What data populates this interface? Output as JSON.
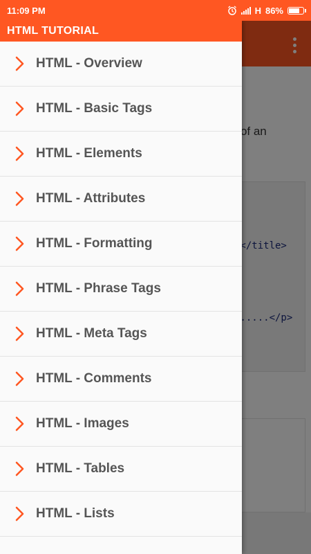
{
  "status": {
    "time": "11:09 PM",
    "network": "H",
    "battery_text": "86%",
    "battery_level": 0.86
  },
  "drawer": {
    "title": "HTML TUTORIAL",
    "items": [
      {
        "label": "HTML - Overview"
      },
      {
        "label": "HTML - Basic Tags"
      },
      {
        "label": "HTML - Elements"
      },
      {
        "label": "HTML - Attributes"
      },
      {
        "label": "HTML - Formatting"
      },
      {
        "label": "HTML - Phrase Tags"
      },
      {
        "label": "HTML - Meta Tags"
      },
      {
        "label": "HTML - Comments"
      },
      {
        "label": "HTML - Images"
      },
      {
        "label": "HTML - Tables"
      },
      {
        "label": "HTML - Lists"
      }
    ]
  },
  "background": {
    "text_fragment": "le of an",
    "code_fragments": [
      "e</title>",
      "e.....</p>"
    ]
  },
  "colors": {
    "accent": "#ff5722",
    "chevron": "#ff5722",
    "label": "#555555"
  },
  "icons": {
    "chevron": "chevron-right-icon",
    "alarm": "alarm-icon",
    "menu": "overflow-menu-icon"
  }
}
